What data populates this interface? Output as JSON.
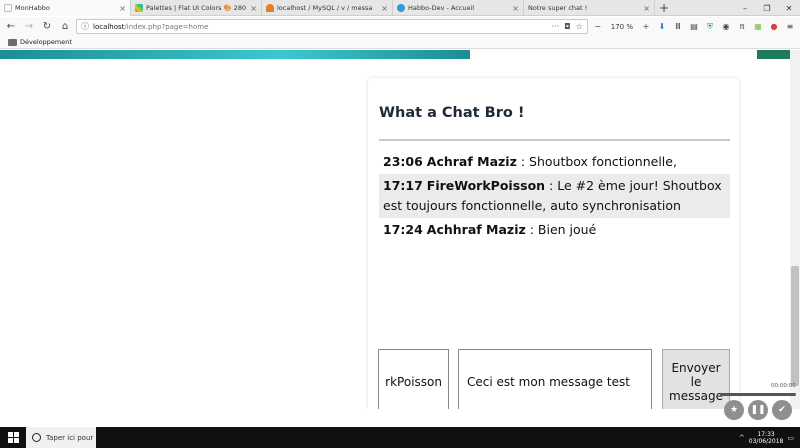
{
  "browser": {
    "tabs": [
      {
        "title": "MonHabbo",
        "favicon_color": "#ffffff",
        "active": true
      },
      {
        "title": "Palettes | Flat UI Colors 🎨 280",
        "favicon_color": "#e74c3c",
        "active": false
      },
      {
        "title": "localhost / MySQL / v / messa",
        "favicon_color": "#e67e22",
        "active": false
      },
      {
        "title": "Habbo-Dev - Accueil",
        "favicon_color": "#3498db",
        "active": false
      },
      {
        "title": "Notre super chat !",
        "favicon_color": "#ffffff",
        "active": false
      }
    ],
    "new_tab": "+",
    "window_controls": {
      "minimize": "–",
      "restore": "❐",
      "close": "✕"
    },
    "url": "localhost/index.php?page=home",
    "url_host": "localhost",
    "url_path": "/index.php?page=home",
    "zoom": "170 %",
    "bookmarks": [
      {
        "label": "Développement"
      }
    ]
  },
  "page": {
    "header_colors": {
      "strip": "#3bc8cf",
      "right": "#1f7a5a"
    }
  },
  "chat": {
    "title": "What a Chat Bro !",
    "messages": [
      {
        "time": "23:06",
        "author": "Achraf Maziz",
        "text": " : Shoutbox fonctionnelle,"
      },
      {
        "time": "17:17",
        "author": "FireWorkPoisson",
        "text": " : Le #2 ème jour! Shoutbox est toujours fonctionnelle, auto synchronisation"
      },
      {
        "time": "17:24",
        "author": "Achhraf Maziz",
        "text": " : Bien joué"
      }
    ],
    "pseudo_value": "rkPoisson",
    "message_value": "Ceci est mon message test",
    "send_label": "Envoyer\nle\nmessage"
  },
  "overlay": {
    "time": "00:00:00",
    "buttons": [
      "star-icon",
      "pause-icon",
      "check-icon"
    ]
  },
  "taskbar": {
    "search_placeholder": "Taper ici pour",
    "time": "17:33",
    "date": "03/06/2018"
  }
}
